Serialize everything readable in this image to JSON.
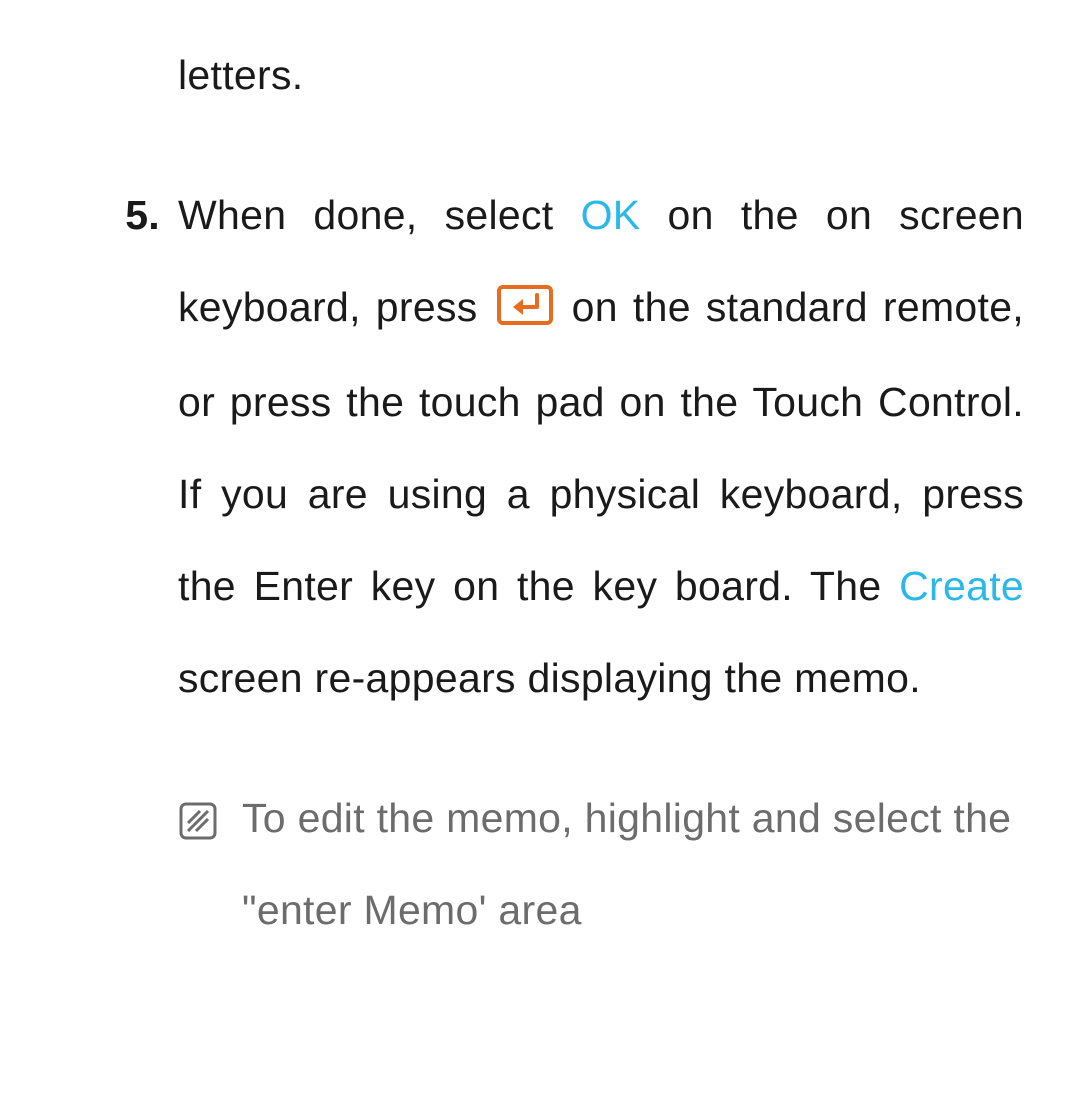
{
  "fragment": "letters.",
  "step": {
    "marker": "5.",
    "part1": "When done, select ",
    "ok": "OK",
    "part2": " on the on screen keyboard, press ",
    "part3": " on the standard remote, or press the touch pad on the Touch Control. If you are using a physical keyboard, press the Enter key on the key board. The ",
    "create": "Create",
    "part4": " screen re-appears displaying the memo."
  },
  "note": {
    "text": "To edit the memo, highlight and select the \"enter Memo' area"
  }
}
